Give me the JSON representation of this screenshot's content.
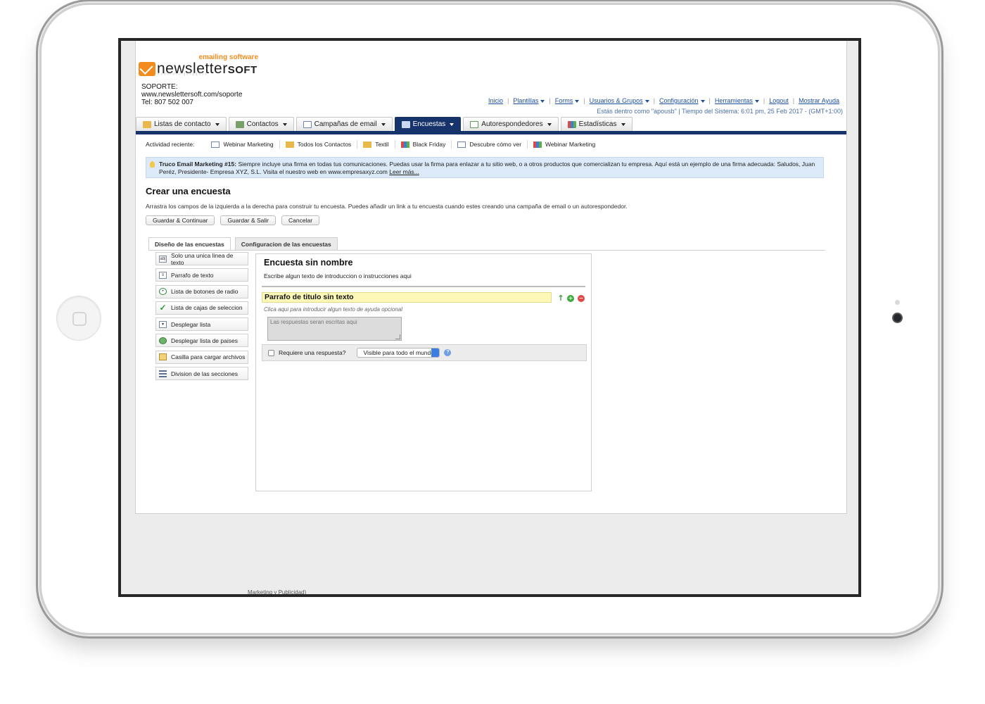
{
  "brand": {
    "tagline": "emailing software",
    "name": "newsletter",
    "name_suffix": "SOFT"
  },
  "support": {
    "label": "SOPORTE:",
    "url": "www.newslettersoft.com/soporte",
    "phone": "Tel: 807 502 007"
  },
  "topnav": {
    "items": [
      "Inicio",
      "Plantillas",
      "Forms",
      "Usuarios & Grupos",
      "Configuración",
      "Herramientas",
      "Logout",
      "Mostrar Ayuda"
    ]
  },
  "status_text": "Estás dentro como \"apousb\" | Tiempo del Sistema: 6:01 pm, 25 Feb 2017 - (GMT+1:00)",
  "main_tabs": [
    "Listas de contacto",
    "Contactos",
    "Campañas de email",
    "Encuestas",
    "Autorespondedores",
    "Estadísticas"
  ],
  "recent": {
    "label": "Actividad reciente:",
    "items": [
      "Webinar Marketing",
      "Todos los Contactos",
      "Textil",
      "Black Friday",
      "Descubre cómo ver",
      "Webinar Marketing"
    ]
  },
  "tip": {
    "title": "Truco Email Marketing #15:",
    "text": " Siempre incluye una firma en todas tus comunicaciones. Puedas usar la firma para enlazar a tu sitio web, o a otros productos que comercializan tu empresa. Aquí está un ejemplo de una firma adecuada: Saludos, Juan Peréz, Presidente- Empresa XYZ, S.L. Visita el nuestro web en www.empresaxyz.com ",
    "more": "Leer más..."
  },
  "page": {
    "title": "Crear una encuesta",
    "description": "Arrastra los campos de la izquierda a la derecha para construir tu encuesta. Puedes añadir un link a tu encuesta cuando estes creando una campaña de email o un autorespondedor.",
    "buttons": [
      "Guardar & Continuar",
      "Guardar & Salir",
      "Cancelar"
    ]
  },
  "subtabs": [
    "Diseño de las encuestas",
    "Configuracion de las encuestas"
  ],
  "palette": [
    "Solo una unica linea de texto",
    "Parrafo de texto",
    "Lista de botones de radio",
    "Lista de cajas de seleccion",
    "Desplegar lista",
    "Desplegar lista de paises",
    "Casilla para cargar archivos",
    "Division de las secciones"
  ],
  "survey": {
    "title": "Encuesta sin nombre",
    "intro": "Escribe algun texto de introduccion o instrucciones aqui",
    "question_title": "Parrafo de titulo sin texto",
    "question_help": "Clica aqui para introducir algun texto de ayuda opcional",
    "answer_placeholder": "Las respuestas seran escritas aqui",
    "required_label": "Requiere una respuesta?",
    "visibility": "Visible para todo el mundo"
  },
  "ghost_text": "Marketing y Publicidad)",
  "colors": {
    "nav_blue": "#17336b",
    "link_blue": "#1d4f9a",
    "accent_orange": "#f28c1e",
    "tip_bg": "#dce9f8",
    "question_bg": "#fdf8b8"
  }
}
